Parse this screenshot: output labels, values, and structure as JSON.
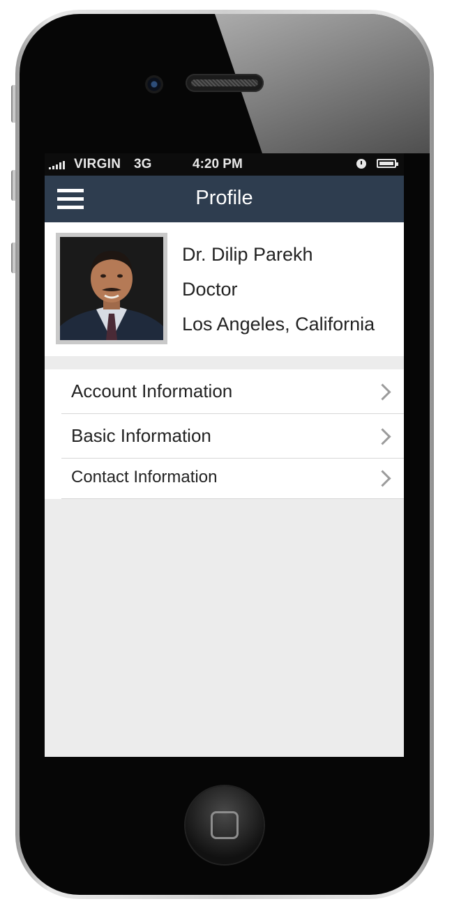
{
  "status_bar": {
    "carrier": "VIRGIN",
    "network": "3G",
    "time": "4:20 PM",
    "alarm_icon": "alarm-clock-icon",
    "battery_icon": "battery-full-icon"
  },
  "navbar": {
    "title": "Profile",
    "menu_icon": "hamburger-menu-icon",
    "background": "#2e3d4f"
  },
  "profile": {
    "name": "Dr. Dilip Parekh",
    "role": "Doctor",
    "location": "Los Angeles, California"
  },
  "menu": {
    "items": [
      {
        "label": "Account Information",
        "icon": "chevron-right-icon"
      },
      {
        "label": "Basic Information",
        "icon": "chevron-right-icon"
      },
      {
        "label": "Contact Information",
        "icon": "chevron-right-icon"
      }
    ]
  },
  "colors": {
    "screen_background": "#ececec",
    "nav_background": "#2e3d4f",
    "card_background": "#ffffff",
    "chevron": "#9b9b9b"
  }
}
